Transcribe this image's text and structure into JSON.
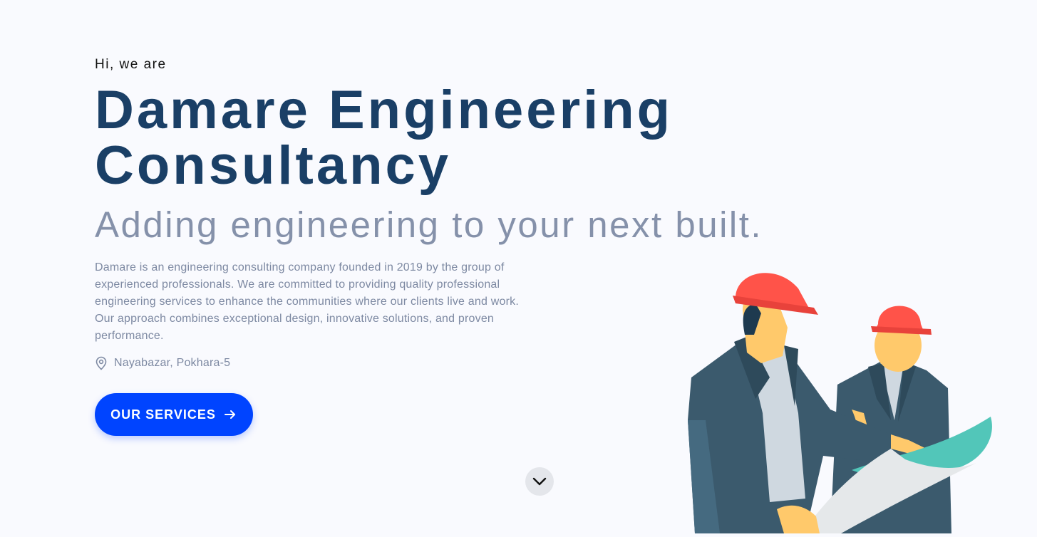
{
  "hero": {
    "greeting": "Hi, we are",
    "title": "Damare Engineering Consultancy",
    "tagline": "Adding engineering to your next built.",
    "description": "Damare is an engineering consulting company founded in 2019 by the group of experienced professionals. We are committed to providing quality professional engineering services to enhance the communities where our clients live and work. Our approach combines exceptional design, innovative solutions, and proven performance.",
    "location": {
      "icon": "map-pin-icon",
      "text": "Nayabazar, Pokhara-5"
    },
    "cta": {
      "label": "OUR SERVICES",
      "icon": "arrow-right-icon"
    }
  },
  "scroll": {
    "icon": "chevron-down-icon"
  },
  "illustration": {
    "description_icon": "engineers-illustration"
  },
  "colors": {
    "background": "#f9fafe",
    "title": "#1a3f66",
    "tagline": "#8591aa",
    "body_text": "#7d89a2",
    "accent": "#0044ff",
    "helmet": "#ff5349",
    "suit": "#3b5a6d",
    "skin": "#ffc96b",
    "blueprint": "#52c6b9"
  }
}
